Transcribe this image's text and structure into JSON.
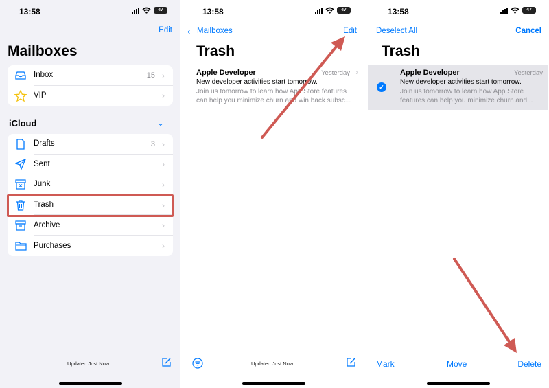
{
  "panel1": {
    "time": "13:58",
    "battery": "47",
    "edit": "Edit",
    "title": "Mailboxes",
    "top_items": [
      {
        "label": "Inbox",
        "count": "15",
        "icon": "inbox-tray-icon"
      },
      {
        "label": "VIP",
        "count": "",
        "icon": "star-icon"
      }
    ],
    "section_title": "iCloud",
    "icloud_items": [
      {
        "label": "Drafts",
        "count": "3",
        "icon": "document-icon"
      },
      {
        "label": "Sent",
        "count": "",
        "icon": "paper-plane-icon"
      },
      {
        "label": "Junk",
        "count": "",
        "icon": "junk-box-icon"
      },
      {
        "label": "Trash",
        "count": "",
        "icon": "trash-icon"
      },
      {
        "label": "Archive",
        "count": "",
        "icon": "archive-box-icon"
      },
      {
        "label": "Purchases",
        "count": "",
        "icon": "folder-icon"
      }
    ],
    "footer": "Updated Just Now"
  },
  "panel2": {
    "time": "13:58",
    "battery": "47",
    "back": "Mailboxes",
    "edit": "Edit",
    "title": "Trash",
    "mail": {
      "sender": "Apple Developer",
      "date": "Yesterday",
      "subject": "New developer activities start tomorrow.",
      "preview_line1": "Join us tomorrow to learn how App Store features",
      "preview_line2": "can help you minimize churn and win back subsc..."
    },
    "footer": "Updated Just Now"
  },
  "panel3": {
    "time": "13:58",
    "battery": "47",
    "deselect_all": "Deselect All",
    "cancel": "Cancel",
    "title": "Trash",
    "mail": {
      "sender": "Apple Developer",
      "date": "Yesterday",
      "subject": "New developer activities start tomorrow.",
      "preview_line1": "Join us tomorrow to learn how App Store",
      "preview_line2": "features can help you minimize churn and..."
    },
    "actions": {
      "mark": "Mark",
      "move": "Move",
      "delete": "Delete"
    }
  },
  "colors": {
    "accent": "#007aff",
    "annotation": "#cf5a54",
    "group_bg": "#f2f2f7"
  }
}
